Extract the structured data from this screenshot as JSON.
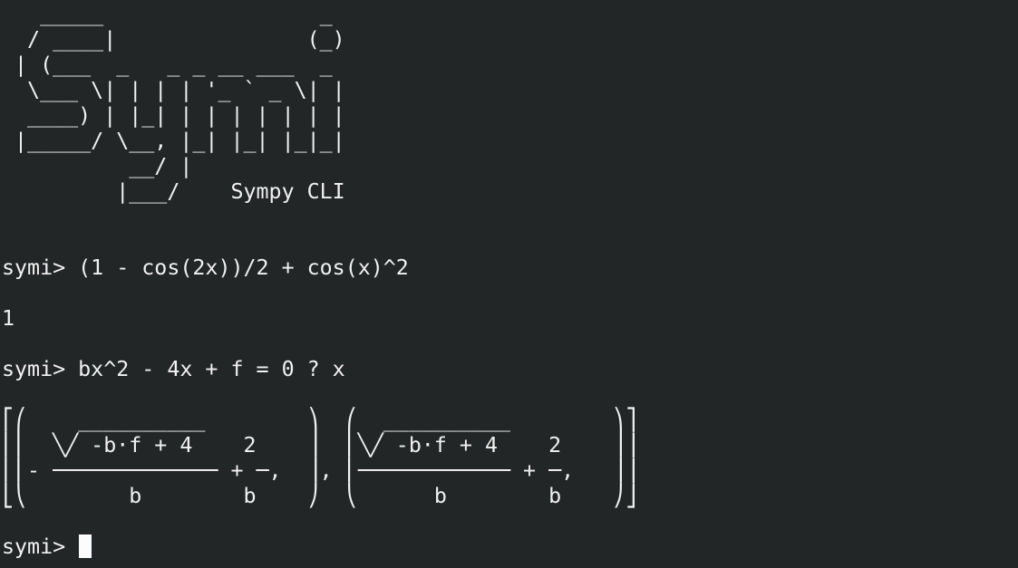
{
  "terminal": {
    "banner": [
      "   _____                 _ ",
      "  / ____|               (_)",
      " | (___  _   _ _ __ ___  _ ",
      "  \\___ \\| | | | '_ ` _ \\| |",
      "  ____) | |_| | | | | | | |",
      " |_____/ \\__, |_| |_| |_|_|",
      "          __/ |            ",
      "         |___/    Sympy CLI"
    ],
    "session": [
      {
        "kind": "input",
        "text": "symi> (1 - cos(2x))/2 + cos(x)^2"
      },
      {
        "kind": "output",
        "text": "1"
      },
      {
        "kind": "input",
        "text": "symi> bx^2 - 4x + f = 0 ? x"
      },
      {
        "kind": "output",
        "lines": [
          "⎡⎛    __________        ⎞  ⎛  __________        ⎞⎤",
          "⎢⎜  ╲╱ -b⋅f + 4    2    ⎟  ⎜╲╱ -b⋅f + 4    2    ⎟⎥",
          "⎢⎜- ───────────── + ─,  ⎟, ⎜──────────── + ─,   ⎟⎥",
          "⎣⎝        b        b    ⎠  ⎝      b        b    ⎠⎦"
        ]
      },
      {
        "kind": "prompt",
        "text": "symi> "
      }
    ]
  }
}
